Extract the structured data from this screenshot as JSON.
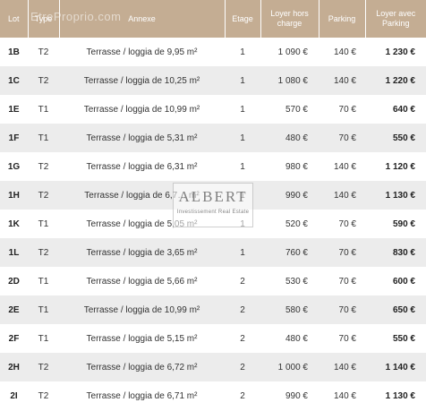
{
  "headers": {
    "lot": "Lot",
    "type": "Type",
    "annexe": "Annexe",
    "etage": "Etage",
    "loyer_hors_charge": "Loyer hors charge",
    "parking": "Parking",
    "loyer_avec_parking": "Loyer avec Parking"
  },
  "rows": [
    {
      "lot": "1B",
      "type": "T2",
      "annexe": "Terrasse / loggia de 9,95 m²",
      "etage": "1",
      "loyer": "1 090 €",
      "parking": "140 €",
      "loyer_avec": "1 230 €"
    },
    {
      "lot": "1C",
      "type": "T2",
      "annexe": "Terrasse / loggia de 10,25 m²",
      "etage": "1",
      "loyer": "1 080 €",
      "parking": "140 €",
      "loyer_avec": "1 220 €"
    },
    {
      "lot": "1E",
      "type": "T1",
      "annexe": "Terrasse / loggia de 10,99 m²",
      "etage": "1",
      "loyer": "570 €",
      "parking": "70 €",
      "loyer_avec": "640 €"
    },
    {
      "lot": "1F",
      "type": "T1",
      "annexe": "Terrasse / loggia de 5,31 m²",
      "etage": "1",
      "loyer": "480 €",
      "parking": "70 €",
      "loyer_avec": "550 €"
    },
    {
      "lot": "1G",
      "type": "T2",
      "annexe": "Terrasse / loggia de 6,31 m²",
      "etage": "1",
      "loyer": "980 €",
      "parking": "140 €",
      "loyer_avec": "1 120 €"
    },
    {
      "lot": "1H",
      "type": "T2",
      "annexe": "Terrasse / loggia de 6,7… m²",
      "etage": "1",
      "loyer": "990 €",
      "parking": "140 €",
      "loyer_avec": "1 130 €"
    },
    {
      "lot": "1K",
      "type": "T1",
      "annexe": "Terrasse / loggia de 5,05 m²",
      "etage": "1",
      "loyer": "520 €",
      "parking": "70 €",
      "loyer_avec": "590 €"
    },
    {
      "lot": "1L",
      "type": "T2",
      "annexe": "Terrasse / loggia de 3,65 m²",
      "etage": "1",
      "loyer": "760 €",
      "parking": "70 €",
      "loyer_avec": "830 €"
    },
    {
      "lot": "2D",
      "type": "T1",
      "annexe": "Terrasse / loggia de 5,66 m²",
      "etage": "2",
      "loyer": "530 €",
      "parking": "70 €",
      "loyer_avec": "600 €"
    },
    {
      "lot": "2E",
      "type": "T1",
      "annexe": "Terrasse / loggia de 10,99 m²",
      "etage": "2",
      "loyer": "580 €",
      "parking": "70 €",
      "loyer_avec": "650 €"
    },
    {
      "lot": "2F",
      "type": "T1",
      "annexe": "Terrasse / loggia de 5,15 m²",
      "etage": "2",
      "loyer": "480 €",
      "parking": "70 €",
      "loyer_avec": "550 €"
    },
    {
      "lot": "2H",
      "type": "T2",
      "annexe": "Terrasse / loggia de 6,72 m²",
      "etage": "2",
      "loyer": "1 000 €",
      "parking": "140 €",
      "loyer_avec": "1 140 €"
    },
    {
      "lot": "2I",
      "type": "T2",
      "annexe": "Terrasse / loggia de 6,71 m²",
      "etage": "2",
      "loyer": "990 €",
      "parking": "140 €",
      "loyer_avec": "1 130 €"
    }
  ],
  "watermarks": {
    "site": "EtreProprio.com",
    "logo_brand": "ALBERT",
    "logo_sub": "Investissement Real Estate"
  },
  "colors": {
    "header_bg": "#c4ad93",
    "header_text": "#ffffff",
    "row_alt_bg": "#ececec"
  }
}
